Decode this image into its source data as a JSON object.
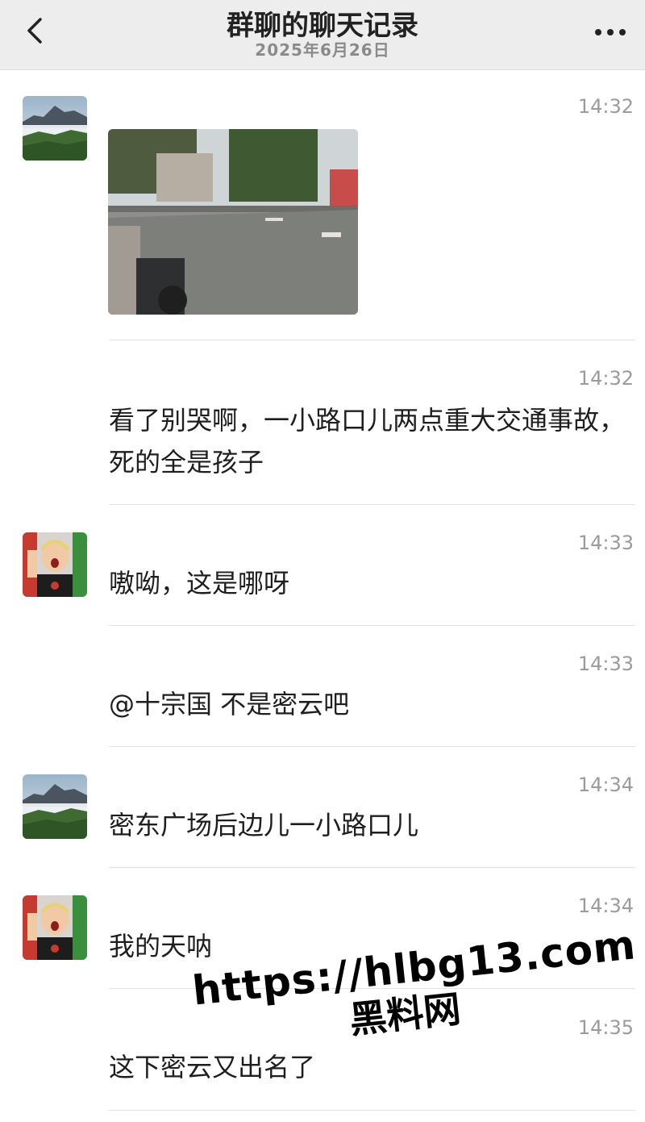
{
  "header": {
    "title": "群聊的聊天记录",
    "date": "2025年6月26日"
  },
  "messages": [
    {
      "time": "14:32",
      "type": "image",
      "avatar": "mountain-avatar"
    },
    {
      "time": "14:32",
      "text": "看了别哭啊，一小路口儿两点重大交通事故，死的全是孩子"
    },
    {
      "time": "14:33",
      "text": "嗷呦，这是哪呀",
      "avatar": "child-avatar"
    },
    {
      "time": "14:33",
      "text": "@十宗国 不是密云吧"
    },
    {
      "time": "14:34",
      "text": "密东广场后边儿一小路口儿",
      "avatar": "mountain-avatar"
    },
    {
      "time": "14:34",
      "text": "我的天呐",
      "avatar": "child-avatar"
    },
    {
      "time": "14:35",
      "text": "这下密云又出名了"
    }
  ],
  "watermark": {
    "url": "https://hlbg13.com",
    "label": "黑料网"
  }
}
